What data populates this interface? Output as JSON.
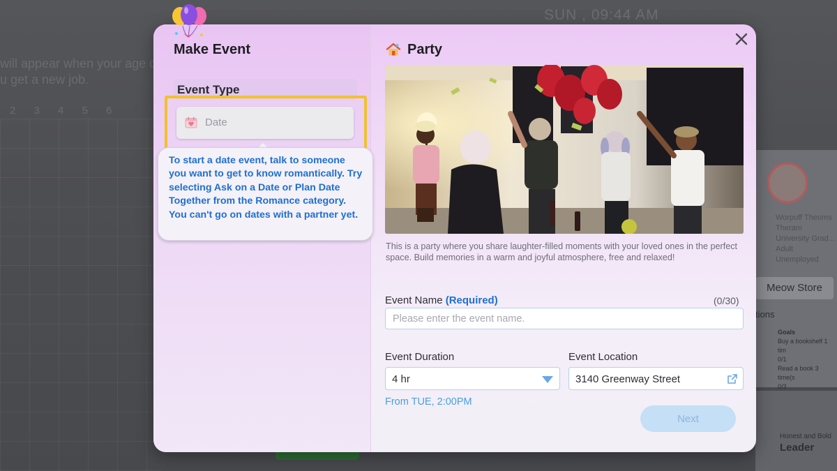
{
  "background": {
    "clock": "SUN , 09:44 AM",
    "hint_lines": [
      "will appear when your age c",
      "u get a new job."
    ],
    "day_numbers": "2 3 4 5 6",
    "side_card_lines": [
      "Worpuff Theoms",
      "Theram",
      "University Grad...",
      "Adult",
      "Unemployed"
    ],
    "meow_store": "Meow Store",
    "actions": "tions",
    "goals_title": "Goals",
    "goal_1": "Buy a bookshelf 1 tim",
    "goal_1_progress": "0/1",
    "goal_2": "Read a book 3 time(s",
    "goal_2_progress": "0/3",
    "trait_sub": "Honest and Bold",
    "trait_title": "Leader"
  },
  "modal": {
    "title": "Make Event",
    "event_type_label": "Event Type",
    "event_type_value": "Date",
    "tooltip_text": "To start a date event, talk to someone you want to get to know romantically. Try selecting Ask on a Date or Plan Date Together from the Romance category. You can't go on dates with a partner yet.",
    "party_title": "Party",
    "party_description": "This is a party where you share laughter-filled moments with your loved ones in the perfect space. Build memories in a warm and joyful atmosphere, free and relaxed!",
    "event_name_label": "Event Name",
    "event_name_required": "(Required)",
    "event_name_counter": "(0/30)",
    "event_name_placeholder": "Please enter the event name.",
    "event_name_value": "",
    "duration_label": "Event Duration",
    "duration_value": "4 hr",
    "location_label": "Event Location",
    "location_value": "3140 Greenway Street",
    "from_text": "From TUE, 2:00PM",
    "next_label": "Next"
  },
  "colors": {
    "highlight": "#f2c12e",
    "link_blue": "#1f6fd0",
    "next_disabled": "#c4dff6"
  }
}
